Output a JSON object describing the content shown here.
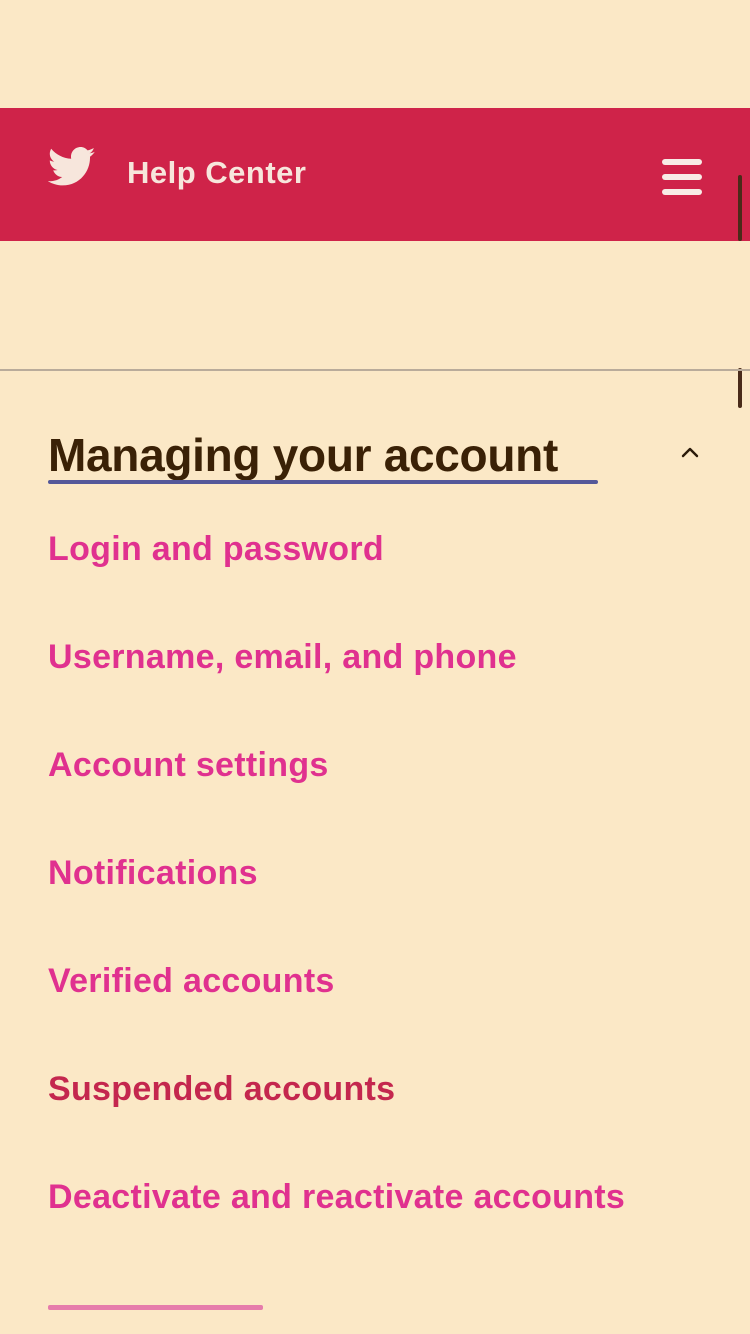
{
  "header": {
    "title": "Help Center",
    "logo_icon": "twitter-bird-icon",
    "menu_icon": "hamburger-menu-icon",
    "background_color": "#cf2349"
  },
  "section": {
    "title": "Managing your account",
    "toggle_icon": "chevron-up-icon",
    "expanded": true
  },
  "nav": {
    "items": [
      {
        "label": "Login and password"
      },
      {
        "label": "Username, email, and phone"
      },
      {
        "label": "Account settings"
      },
      {
        "label": "Notifications"
      },
      {
        "label": "Verified accounts"
      },
      {
        "label": "Suspended accounts"
      },
      {
        "label": "Deactivate and reactivate accounts"
      }
    ]
  },
  "colors": {
    "page_background": "#fbe8c6",
    "link": "#e0318f",
    "active_link": "#c4274e",
    "heading": "#3a2106"
  }
}
